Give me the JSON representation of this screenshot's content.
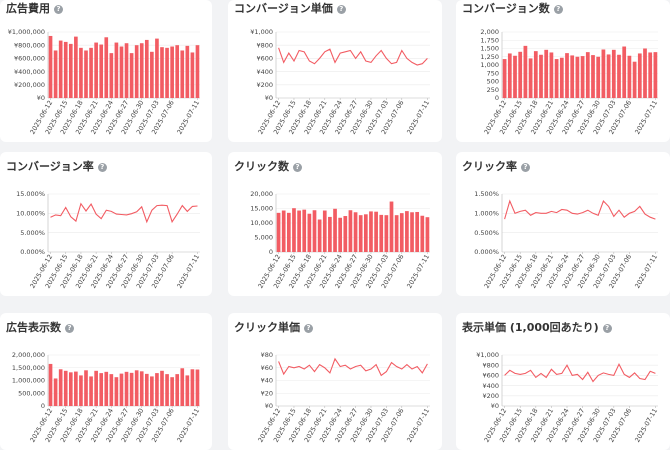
{
  "accent_color": "#f25c63",
  "charts": [
    {
      "title": "広告費用",
      "chart_data": {
        "type": "bar",
        "ylim": [
          0,
          1000000
        ],
        "yticks": [
          "¥0",
          "¥200,000",
          "¥400,000",
          "¥600,000",
          "¥800,000",
          "¥1,000,000"
        ],
        "values": [
          940000,
          720000,
          870000,
          850000,
          820000,
          930000,
          760000,
          720000,
          760000,
          840000,
          810000,
          920000,
          680000,
          840000,
          780000,
          830000,
          680000,
          800000,
          830000,
          880000,
          700000,
          900000,
          770000,
          760000,
          780000,
          800000,
          720000,
          790000,
          690000,
          800000
        ]
      }
    },
    {
      "title": "コンバージョン単価",
      "chart_data": {
        "type": "line",
        "ylim": [
          0,
          1000
        ],
        "yticks": [
          "¥0",
          "¥200",
          "¥400",
          "¥600",
          "¥800",
          "¥1,000"
        ],
        "values": [
          760,
          540,
          680,
          560,
          720,
          700,
          560,
          520,
          600,
          700,
          740,
          540,
          680,
          700,
          720,
          600,
          700,
          560,
          540,
          640,
          720,
          600,
          520,
          540,
          720,
          600,
          540,
          500,
          520,
          600
        ]
      }
    },
    {
      "title": "コンバージョン数",
      "chart_data": {
        "type": "bar",
        "ylim": [
          0,
          2000
        ],
        "yticks": [
          "0",
          "250",
          "500",
          "750",
          "1,000",
          "1,250",
          "1,500",
          "1,750",
          "2,000"
        ],
        "values": [
          1180,
          1350,
          1280,
          1400,
          1580,
          1200,
          1420,
          1310,
          1460,
          1380,
          1180,
          1220,
          1360,
          1290,
          1250,
          1270,
          1390,
          1300,
          1250,
          1470,
          1320,
          1460,
          1310,
          1560,
          1280,
          1100,
          1350,
          1500,
          1380,
          1390
        ]
      }
    },
    {
      "title": "コンバージョン率",
      "chart_data": {
        "type": "line",
        "ylim": [
          0,
          15
        ],
        "yticks": [
          "0.000%",
          "5.000%",
          "10.000%",
          "15.000%"
        ],
        "values": [
          9.0,
          9.6,
          9.4,
          11.5,
          9.1,
          8.0,
          12.5,
          10.6,
          12.4,
          9.8,
          8.6,
          10.8,
          10.5,
          9.8,
          9.7,
          9.6,
          9.9,
          10.4,
          11.7,
          7.8,
          10.8,
          12.0,
          12.1,
          12.0,
          7.8,
          9.8,
          12.0,
          10.5,
          11.8,
          11.9
        ]
      }
    },
    {
      "title": "クリック数",
      "chart_data": {
        "type": "bar",
        "ylim": [
          0,
          20000
        ],
        "yticks": [
          "0",
          "5,000",
          "10,000",
          "15,000",
          "20,000"
        ],
        "values": [
          13500,
          14300,
          13500,
          15100,
          14300,
          14600,
          13200,
          14400,
          11200,
          14300,
          12100,
          14900,
          11800,
          12400,
          14400,
          13700,
          12700,
          13000,
          14000,
          13900,
          12800,
          12700,
          17400,
          12700,
          13400,
          14100,
          13700,
          13800,
          12500,
          12000
        ]
      }
    },
    {
      "title": "クリック率",
      "chart_data": {
        "type": "line",
        "ylim": [
          0,
          1.5
        ],
        "yticks": [
          "0.000%",
          "0.500%",
          "1.000%",
          "1.500%"
        ],
        "values": [
          0.85,
          1.32,
          1.0,
          1.05,
          1.08,
          0.95,
          1.02,
          1.0,
          1.0,
          1.05,
          1.02,
          1.1,
          1.08,
          1.0,
          0.98,
          1.02,
          1.08,
          1.0,
          0.95,
          1.32,
          1.18,
          0.92,
          1.08,
          0.9,
          1.0,
          1.05,
          1.18,
          0.98,
          0.9,
          0.85
        ]
      }
    },
    {
      "title": "広告表示数",
      "chart_data": {
        "type": "bar",
        "ylim": [
          0,
          2000000
        ],
        "yticks": [
          "0",
          "500,000",
          "1,000,000",
          "1,500,000",
          "2,000,000"
        ],
        "values": [
          1650000,
          1080000,
          1440000,
          1380000,
          1320000,
          1350000,
          1200000,
          1400000,
          1160000,
          1380000,
          1290000,
          1340000,
          1250000,
          1130000,
          1270000,
          1340000,
          1300000,
          1400000,
          1360000,
          1260000,
          1160000,
          1290000,
          1380000,
          1250000,
          1130000,
          1250000,
          1480000,
          1200000,
          1440000,
          1430000
        ]
      }
    },
    {
      "title": "クリック単価",
      "chart_data": {
        "type": "line",
        "ylim": [
          0,
          80
        ],
        "yticks": [
          "¥0",
          "¥20",
          "¥40",
          "¥60",
          "¥80"
        ],
        "values": [
          70,
          50,
          62,
          60,
          62,
          58,
          64,
          54,
          65,
          60,
          52,
          74,
          62,
          64,
          58,
          62,
          64,
          55,
          58,
          65,
          48,
          54,
          68,
          62,
          58,
          65,
          58,
          62,
          52,
          66
        ]
      }
    },
    {
      "title": "表示単価 (1,000回あたり)",
      "chart_data": {
        "type": "line",
        "ylim": [
          0,
          1000
        ],
        "yticks": [
          "¥0",
          "¥200",
          "¥400",
          "¥600",
          "¥800",
          "¥1,000"
        ],
        "values": [
          600,
          700,
          640,
          620,
          640,
          700,
          560,
          640,
          560,
          720,
          620,
          640,
          800,
          600,
          620,
          520,
          660,
          480,
          600,
          650,
          620,
          600,
          820,
          620,
          560,
          650,
          540,
          520,
          680,
          640
        ]
      }
    }
  ],
  "xticks": [
    "2025-06-12",
    "2025-06-15",
    "2025-06-18",
    "2025-06-21",
    "2025-06-24",
    "2025-06-27",
    "2025-06-30",
    "2025-07-03",
    "2025-07-06",
    "2025-07-11"
  ],
  "xtick_positions": [
    0,
    3,
    6,
    9,
    12,
    15,
    18,
    21,
    24,
    29
  ]
}
